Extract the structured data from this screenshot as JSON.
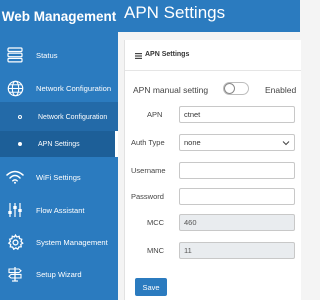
{
  "sidebar": {
    "brand": "Web Management",
    "items": [
      {
        "label": "Status",
        "icon": "storage-stack-icon"
      },
      {
        "label": "Network Configuration",
        "icon": "globe-icon"
      },
      {
        "label": "WiFi Settings",
        "icon": "wifi-icon"
      },
      {
        "label": "Flow Assistant",
        "icon": "sliders-icon"
      },
      {
        "label": "System Management",
        "icon": "gear-icon"
      },
      {
        "label": "Setup Wizard",
        "icon": "signpost-icon"
      }
    ],
    "subitems": [
      {
        "label": "Network Configuration"
      },
      {
        "label": "APN Settings",
        "active": true
      }
    ]
  },
  "header": {
    "title": "APN Settings"
  },
  "panel": {
    "title": "APN Settings",
    "apn_manual_label": "APN manual setting",
    "apn_manual_state": "Enabled",
    "fields": {
      "apn": {
        "label": "APN",
        "value": "ctnet"
      },
      "auth_type": {
        "label": "Auth Type",
        "value": "none"
      },
      "username": {
        "label": "Username",
        "value": ""
      },
      "password": {
        "label": "Password",
        "value": ""
      },
      "mcc": {
        "label": "MCC",
        "value": "460"
      },
      "mnc": {
        "label": "MNC",
        "value": "11"
      }
    },
    "save_label": "Save"
  },
  "colors": {
    "accent": "#2b7bbf",
    "sub_bg": "#236aa8",
    "active_bg": "#1d5f98"
  }
}
